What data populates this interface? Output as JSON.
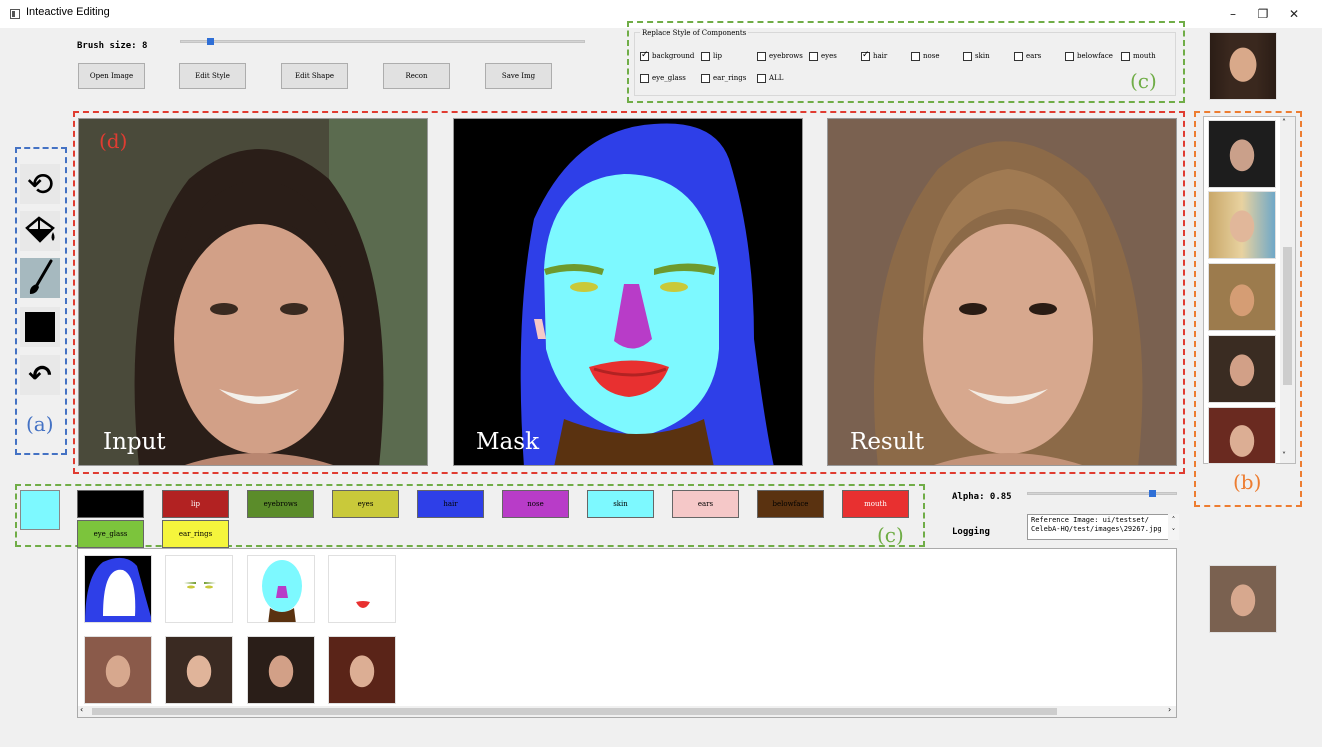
{
  "window": {
    "title": "Inteactive Editing",
    "controls": {
      "minimize": "–",
      "restore": "❐",
      "close": "✕"
    }
  },
  "brush": {
    "label": "Brush size: 8",
    "level": 0.08
  },
  "buttons": {
    "open": "Open Image",
    "edit_style": "Edit Style",
    "edit_shape": "Edit Shape",
    "recon": "Recon",
    "save": "Save Img"
  },
  "components": {
    "group_title": "Replace Style of Components",
    "items": [
      {
        "label": "background",
        "checked": true
      },
      {
        "label": "lip",
        "checked": false
      },
      {
        "label": "eyebrows",
        "checked": false
      },
      {
        "label": "eyes",
        "checked": false
      },
      {
        "label": "hair",
        "checked": true
      },
      {
        "label": "nose",
        "checked": false
      },
      {
        "label": "skin",
        "checked": false
      },
      {
        "label": "ears",
        "checked": false
      },
      {
        "label": "belowface",
        "checked": false
      },
      {
        "label": "mouth",
        "checked": false
      },
      {
        "label": "eye_glass",
        "checked": false
      },
      {
        "label": "ear_rings",
        "checked": false
      },
      {
        "label": "ALL",
        "checked": false
      }
    ]
  },
  "annotations": {
    "a": "(a)",
    "b": "(b)",
    "c": "(c)",
    "d": "(d)",
    "colors": {
      "a": "#4472c4",
      "b": "#ed7d31",
      "c": "#70ad47",
      "d": "#e03c31"
    }
  },
  "tools": [
    {
      "name": "reset-icon",
      "glyph": "⟲"
    },
    {
      "name": "fill-bucket-icon",
      "glyph": ""
    },
    {
      "name": "brush-icon",
      "glyph": ""
    },
    {
      "name": "color-square-icon",
      "glyph": ""
    },
    {
      "name": "undo-icon",
      "glyph": "↶"
    }
  ],
  "panels": {
    "input": "Input",
    "mask": "Mask",
    "result": "Result"
  },
  "palette": {
    "current": "#7df9ff",
    "swatches": [
      {
        "label": "",
        "color": "#000000",
        "text": "#ffffff"
      },
      {
        "label": "lip",
        "color": "#b22222",
        "text": "#ffffff"
      },
      {
        "label": "eyebrows",
        "color": "#5b8c2a",
        "text": "#000000"
      },
      {
        "label": "eyes",
        "color": "#c9c93a",
        "text": "#000000"
      },
      {
        "label": "hair",
        "color": "#2e3fe8",
        "text": "#000000"
      },
      {
        "label": "nose",
        "color": "#b83cc8",
        "text": "#000000"
      },
      {
        "label": "skin",
        "color": "#7df9ff",
        "text": "#000000"
      },
      {
        "label": "ears",
        "color": "#f5c8c8",
        "text": "#000000"
      },
      {
        "label": "belowface",
        "color": "#5a3210",
        "text": "#000000"
      },
      {
        "label": "mouth",
        "color": "#e83030",
        "text": "#ffffff"
      },
      {
        "label": "eye_glass",
        "color": "#7cc43c",
        "text": "#000000"
      },
      {
        "label": "ear_rings",
        "color": "#f5f53c",
        "text": "#000000"
      }
    ]
  },
  "alpha": {
    "label": "Alpha: 0.85",
    "value": 0.85
  },
  "logging": {
    "label": "Logging",
    "text": "Reference Image: ui/testset/ CelebA-HQ/test/images\\29267.jpg"
  }
}
